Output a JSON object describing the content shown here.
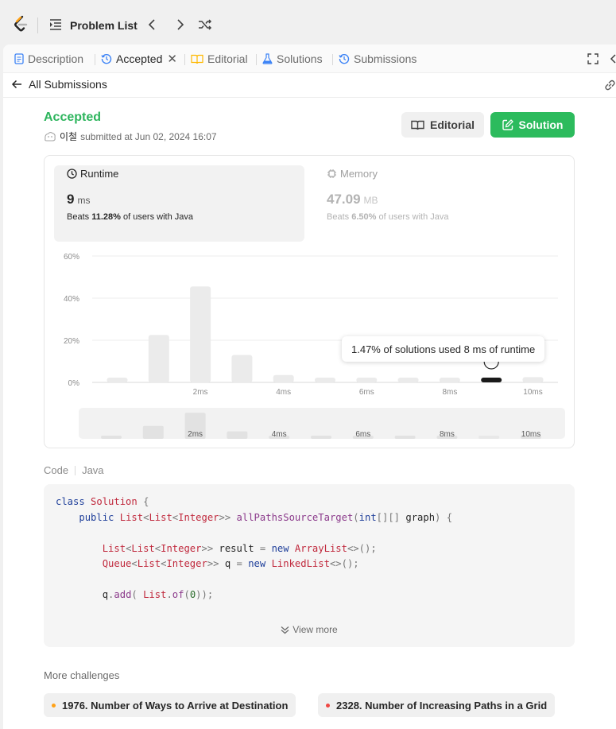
{
  "topbar": {
    "problem_list_label": "Problem List"
  },
  "tabs": [
    {
      "label": "Description"
    },
    {
      "label": "Accepted"
    },
    {
      "label": "Editorial"
    },
    {
      "label": "Solutions"
    },
    {
      "label": "Submissions"
    }
  ],
  "back_label": "All Submissions",
  "submission": {
    "status": "Accepted",
    "user": "이철",
    "submitted_text": "submitted at Jun 02, 2024 16:07"
  },
  "buttons": {
    "editorial": "Editorial",
    "solution": "Solution"
  },
  "runtime": {
    "title": "Runtime",
    "value": "9",
    "unit": "ms",
    "beats_prefix": "Beats",
    "beats_pct": "11.28%",
    "beats_suffix": "of users with Java"
  },
  "memory": {
    "title": "Memory",
    "value": "47.09",
    "unit": "MB",
    "beats_prefix": "Beats",
    "beats_pct": "6.50%",
    "beats_suffix": "of users with Java"
  },
  "chart_data": {
    "type": "bar",
    "y_ticks": [
      "60%",
      "40%",
      "20%",
      "0%"
    ],
    "ylim": [
      0,
      60
    ],
    "bins": [
      0,
      1,
      2,
      3,
      4,
      5,
      6,
      7,
      8,
      9,
      10
    ],
    "x_ticks": [
      {
        "bin": 2,
        "label": "2ms"
      },
      {
        "bin": 4,
        "label": "4ms"
      },
      {
        "bin": 6,
        "label": "6ms"
      },
      {
        "bin": 8,
        "label": "8ms"
      },
      {
        "bin": 10,
        "label": "10ms"
      }
    ],
    "values": [
      2,
      22.5,
      45.5,
      13,
      3.5,
      2,
      2,
      2,
      2,
      1.47,
      2.5
    ],
    "highlight_bin": 9,
    "tooltip": "1.47% of solutions used 8 ms of runtime",
    "bar_color": "#ebebeb",
    "highlight_color": "#1a1a1a"
  },
  "code": {
    "header": "Code",
    "language": "Java",
    "view_more": "View more"
  },
  "more": {
    "title": "More challenges",
    "items": [
      {
        "label": "1976. Number of Ways to Arrive at Destination",
        "dot_color": "#ffa116"
      },
      {
        "label": "2328. Number of Increasing Paths in a Grid",
        "dot_color": "#ef4743"
      }
    ]
  }
}
